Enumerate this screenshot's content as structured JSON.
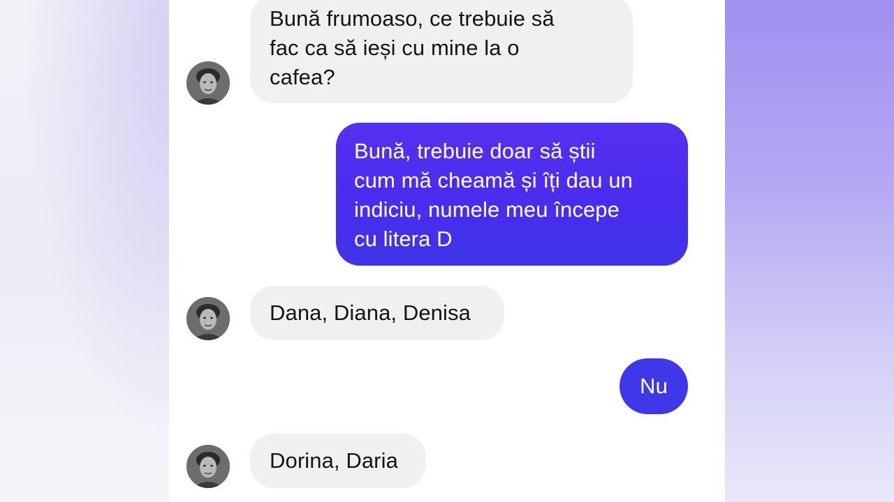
{
  "colors": {
    "incoming_bubble": "#f0f0f0",
    "outgoing_bubble": "#4a2cf0",
    "background": "#ffffff"
  },
  "messages": [
    {
      "direction": "incoming",
      "text": "Bună frumoaso, ce trebuie să fac ca să ieși cu mine la o cafea?",
      "lines": [
        "Bună frumoaso, ce trebuie să",
        "fac ca să ieși cu mine la o",
        "cafea?"
      ],
      "avatar_icon": "user-avatar-icon"
    },
    {
      "direction": "outgoing",
      "text": "Bună, trebuie doar să știi cum mă cheamă și îți dau un indiciu, numele meu începe cu litera D",
      "lines": [
        "Bună, trebuie doar să știi",
        "cum mă cheamă și îți dau un",
        "indiciu, numele meu începe",
        "cu litera D"
      ]
    },
    {
      "direction": "incoming",
      "text": "Dana, Diana, Denisa",
      "avatar_icon": "user-avatar-icon"
    },
    {
      "direction": "outgoing",
      "text": "Nu"
    },
    {
      "direction": "incoming",
      "text": "Dorina, Daria",
      "avatar_icon": "user-avatar-icon"
    }
  ]
}
